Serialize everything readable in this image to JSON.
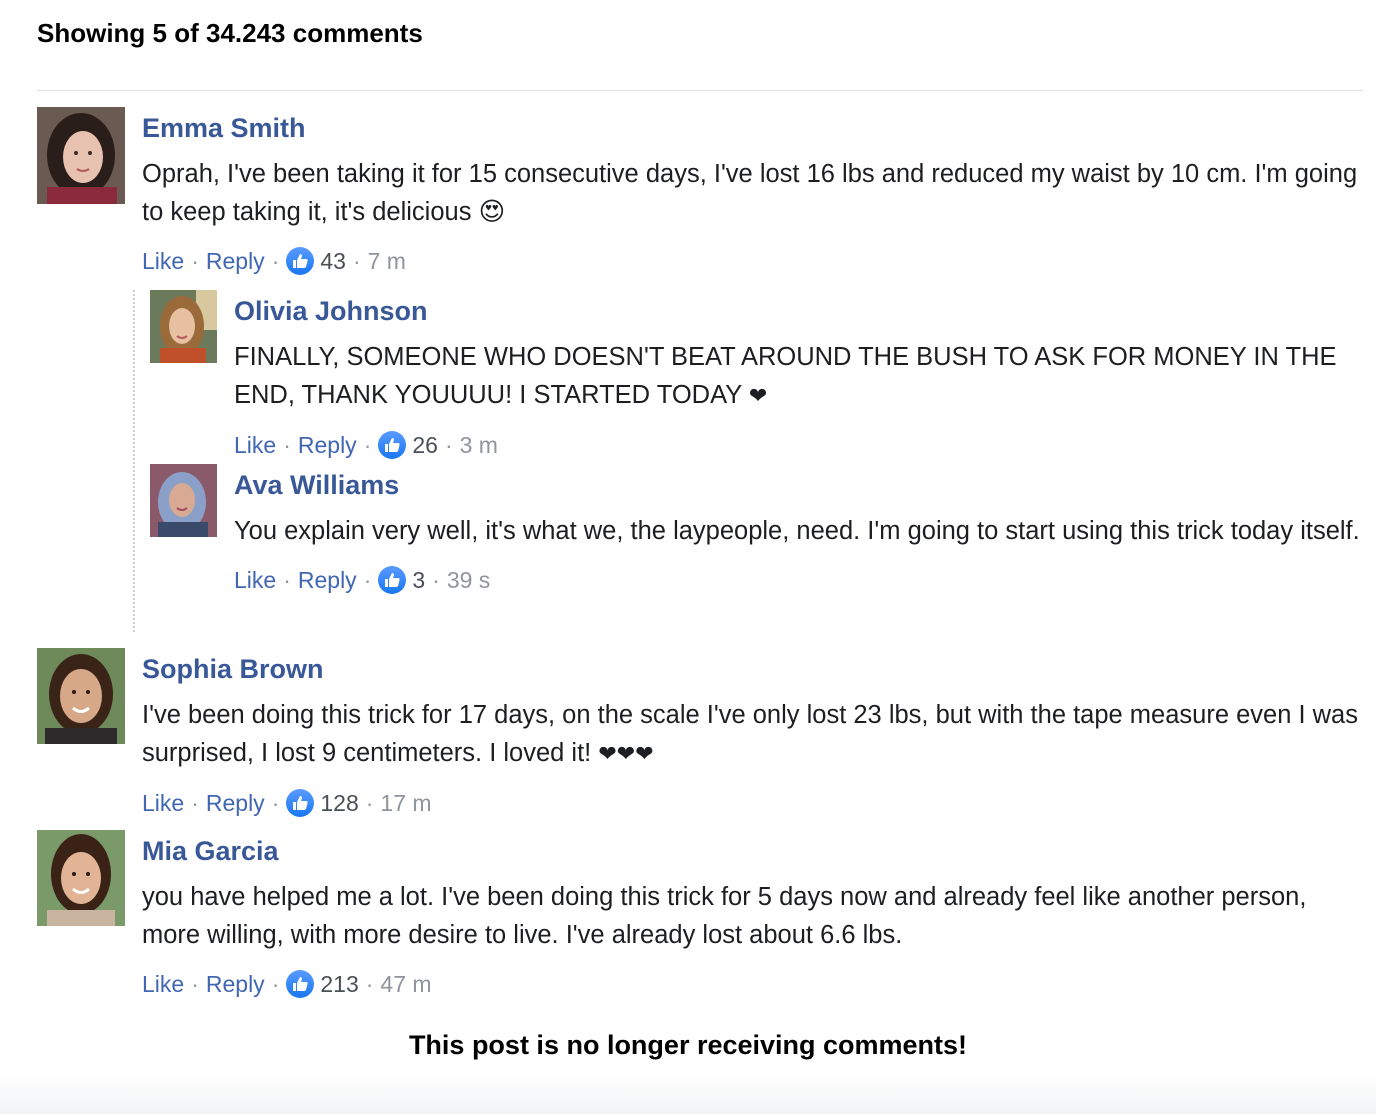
{
  "header": {
    "title": "Showing 5 of 34.243 comments"
  },
  "comments": [
    {
      "author": "Emma Smith",
      "text": "Oprah, I've been taking it for 15 consecutive days, I've lost 16 lbs and reduced my waist by 10 cm. I'm going to keep taking it, it's delicious",
      "emoji": "😍",
      "like_label": "Like",
      "reply_label": "Reply",
      "likes": "43",
      "time": "7 m",
      "avatar_colors": {
        "bg": "#6b5a52",
        "hair": "#2a1e1a",
        "skin": "#e8c2b0",
        "shirt": "#8a2a3a"
      }
    },
    {
      "author": "Sophia Brown",
      "text": "I've been doing this trick for 17 days, on the scale I've only lost 23 lbs, but with the tape measure even I was surprised, I lost 9 centimeters. I loved it!",
      "emoji": "❤❤❤",
      "like_label": "Like",
      "reply_label": "Reply",
      "likes": "128",
      "time": "17 m",
      "avatar_colors": {
        "bg": "#6e8a5a",
        "hair": "#3a2418",
        "skin": "#d6a888",
        "shirt": "#2c2a2a"
      }
    },
    {
      "author": "Mia Garcia",
      "text": "you have helped me a lot. I've been doing this trick for 5 days now and already feel like another person, more willing, with more desire to live. I've already lost about 6.6 lbs.",
      "emoji": "",
      "like_label": "Like",
      "reply_label": "Reply",
      "likes": "213",
      "time": "47 m",
      "avatar_colors": {
        "bg": "#7a9a6a",
        "hair": "#3a2216",
        "skin": "#e0b494",
        "shirt": "#c8b4a0"
      }
    }
  ],
  "replies": [
    {
      "author": "Olivia Johnson",
      "text": "FINALLY, SOMEONE WHO DOESN'T BEAT AROUND THE BUSH TO ASK FOR MONEY IN THE END, THANK YOUUUU! I STARTED TODAY",
      "emoji": "❤",
      "like_label": "Like",
      "reply_label": "Reply",
      "likes": "26",
      "time": "3 m",
      "avatar_colors": {
        "bg": "#6a7a5a",
        "hair": "#9a6a3a",
        "skin": "#e6c0a0",
        "shirt": "#c0502a"
      }
    },
    {
      "author": "Ava Williams",
      "text": "You explain very well, it's what we, the laypeople, need. I'm going to start using this trick today itself.",
      "emoji": "",
      "like_label": "Like",
      "reply_label": "Reply",
      "likes": "3",
      "time": "39 s",
      "avatar_colors": {
        "bg": "#8a5a6a",
        "hair": "#8aa0c8",
        "skin": "#d8aa94",
        "shirt": "#3a4a6a"
      }
    }
  ],
  "footer": {
    "text": "This post is no longer receiving comments!"
  },
  "colors": {
    "author": "#385898",
    "link": "#4267b2",
    "meta": "#90949c",
    "like_badge": "#1877f2"
  }
}
